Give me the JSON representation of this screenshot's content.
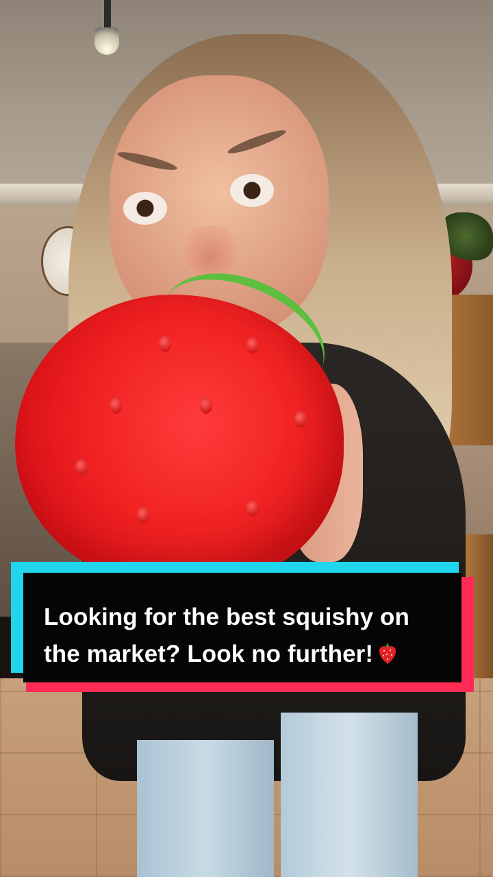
{
  "caption": {
    "line1": "Looking for the best squishy on",
    "line2": "the market? Look no further!",
    "emoji": "strawberry-emoji"
  },
  "colors": {
    "caption_bg": "#050505",
    "caption_text": "#ffffff",
    "tiktok_cyan": "#20d5ec",
    "tiktok_pink": "#fe2c55",
    "squishy_red": "#f02222",
    "leaf_green": "#5cbf3f"
  }
}
